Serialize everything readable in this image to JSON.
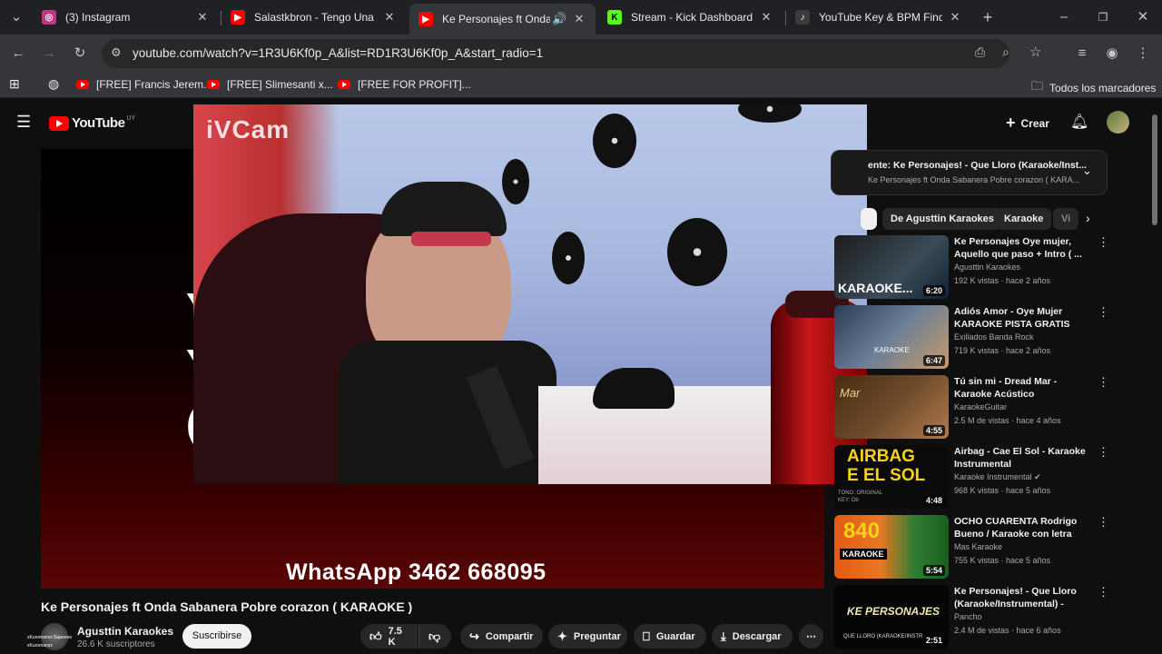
{
  "tabs": [
    {
      "title": "(3) Instagram",
      "icon": "instagram-icon",
      "color": "#c13584"
    },
    {
      "title": "Salastkbron - Tengo Una Ca",
      "icon": "youtube-icon",
      "color": "#ff0000"
    },
    {
      "title": "Ke Personajes ft Onda Sa",
      "icon": "youtube-icon",
      "color": "#ff0000"
    },
    {
      "title": "Stream - Kick Dashboard",
      "icon": "kick-icon",
      "color": "#53fc18"
    },
    {
      "title": "YouTube Key & BPM Finder",
      "icon": "music-icon",
      "color": "#3c3c3c"
    }
  ],
  "toolbar": {
    "url": "youtube.com/watch?v=1R3U6Kf0p_A&list=RD1R3U6Kf0p_A&start_radio=1"
  },
  "bookmarks": {
    "items": [
      "[FREE] Francis Jerem...",
      "[FREE] Slimesanti x...",
      "[FREE FOR PROFIT]..."
    ],
    "all_label": "Todos los marcadores"
  },
  "header": {
    "logo": "YouTube",
    "country": "UY",
    "create_label": "Crear"
  },
  "player": {
    "overlay_brand": "iVCam",
    "whatsapp": "WhatsApp 3462 668095"
  },
  "video": {
    "title": "Ke Personajes ft Onda Sabanera Pobre corazon ( KARAOKE )",
    "channel": "Agusttin Karaokes",
    "subscribers": "26.6 K suscriptores",
    "subscribe_label": "Suscribirse",
    "likes": "7.5 K",
    "share_label": "Compartir",
    "ask_label": "Preguntar",
    "save_label": "Guardar",
    "download_label": "Descargar",
    "avatar_text1": "xKuromanxx Sapeeee",
    "avatar_text2": "xKuromanxx"
  },
  "playlist": {
    "title": "ente: Ke Personajes! - Que Lloro (Karaoke/Inst...",
    "subtitle": "Ke Personajes ft Onda Sabanera Pobre corazon ( KARA..."
  },
  "chips": [
    "De Agusttin Karaokes",
    "Karaoke",
    "Vi"
  ],
  "recommendations": [
    {
      "title": "Ke Personajes Oye mujer, Aquello que paso + Intro ( ...",
      "channel": "Agusttin Karaokes",
      "meta": "192 K vistas · hace 2 años",
      "duration": "6:20",
      "thumb_text": "KARAOKE..."
    },
    {
      "title": "Adiós Amor - Oye Mujer KARAOKE PISTA GRATIS (Low...",
      "channel": "Exiliados Banda Rock",
      "meta": "719 K vistas · hace 2 años",
      "duration": "6:47",
      "thumb_text": "KARAOKE"
    },
    {
      "title": "Tú sin mi - Dread Mar - Karaoke Acústico",
      "channel": "KaraokeGuitar",
      "meta": "2.5 M de vistas · hace 4 años",
      "duration": "4:55",
      "thumb_text": "Mar"
    },
    {
      "title": "Airbag - Cae El Sol - Karaoke Instrumental",
      "channel": "Karaoke Instrumental",
      "meta": "968 K vistas · hace 5 años",
      "duration": "4:48",
      "thumb_text": "AIRBAG\nE EL SOL",
      "verified": true
    },
    {
      "title": "OCHO CUARENTA Rodrigo Bueno / Karaoke con letra",
      "channel": "Mas Karaoke",
      "meta": "755 K vistas · hace 5 años",
      "duration": "5:54",
      "thumb_text": "840"
    },
    {
      "title": "Ke Personajes! - Que Lloro (Karaoke/Instrumental) - (Letra)",
      "channel": "Pancho",
      "meta": "2.4 M de vistas · hace 6 años",
      "duration": "2:51",
      "thumb_text": "KE PERSONAJES"
    }
  ],
  "airbag_tone": "TONO: ORIGINAL",
  "airbag_key": "KEY: Db",
  "thumb_sub_840": "KARAOKE",
  "thumb_sub_ke": "QUE LLORO (KARAOKE/INSTR...",
  "colors": {
    "accent": "#ff0000",
    "background": "#0f0f0f",
    "chip": "#272727"
  }
}
